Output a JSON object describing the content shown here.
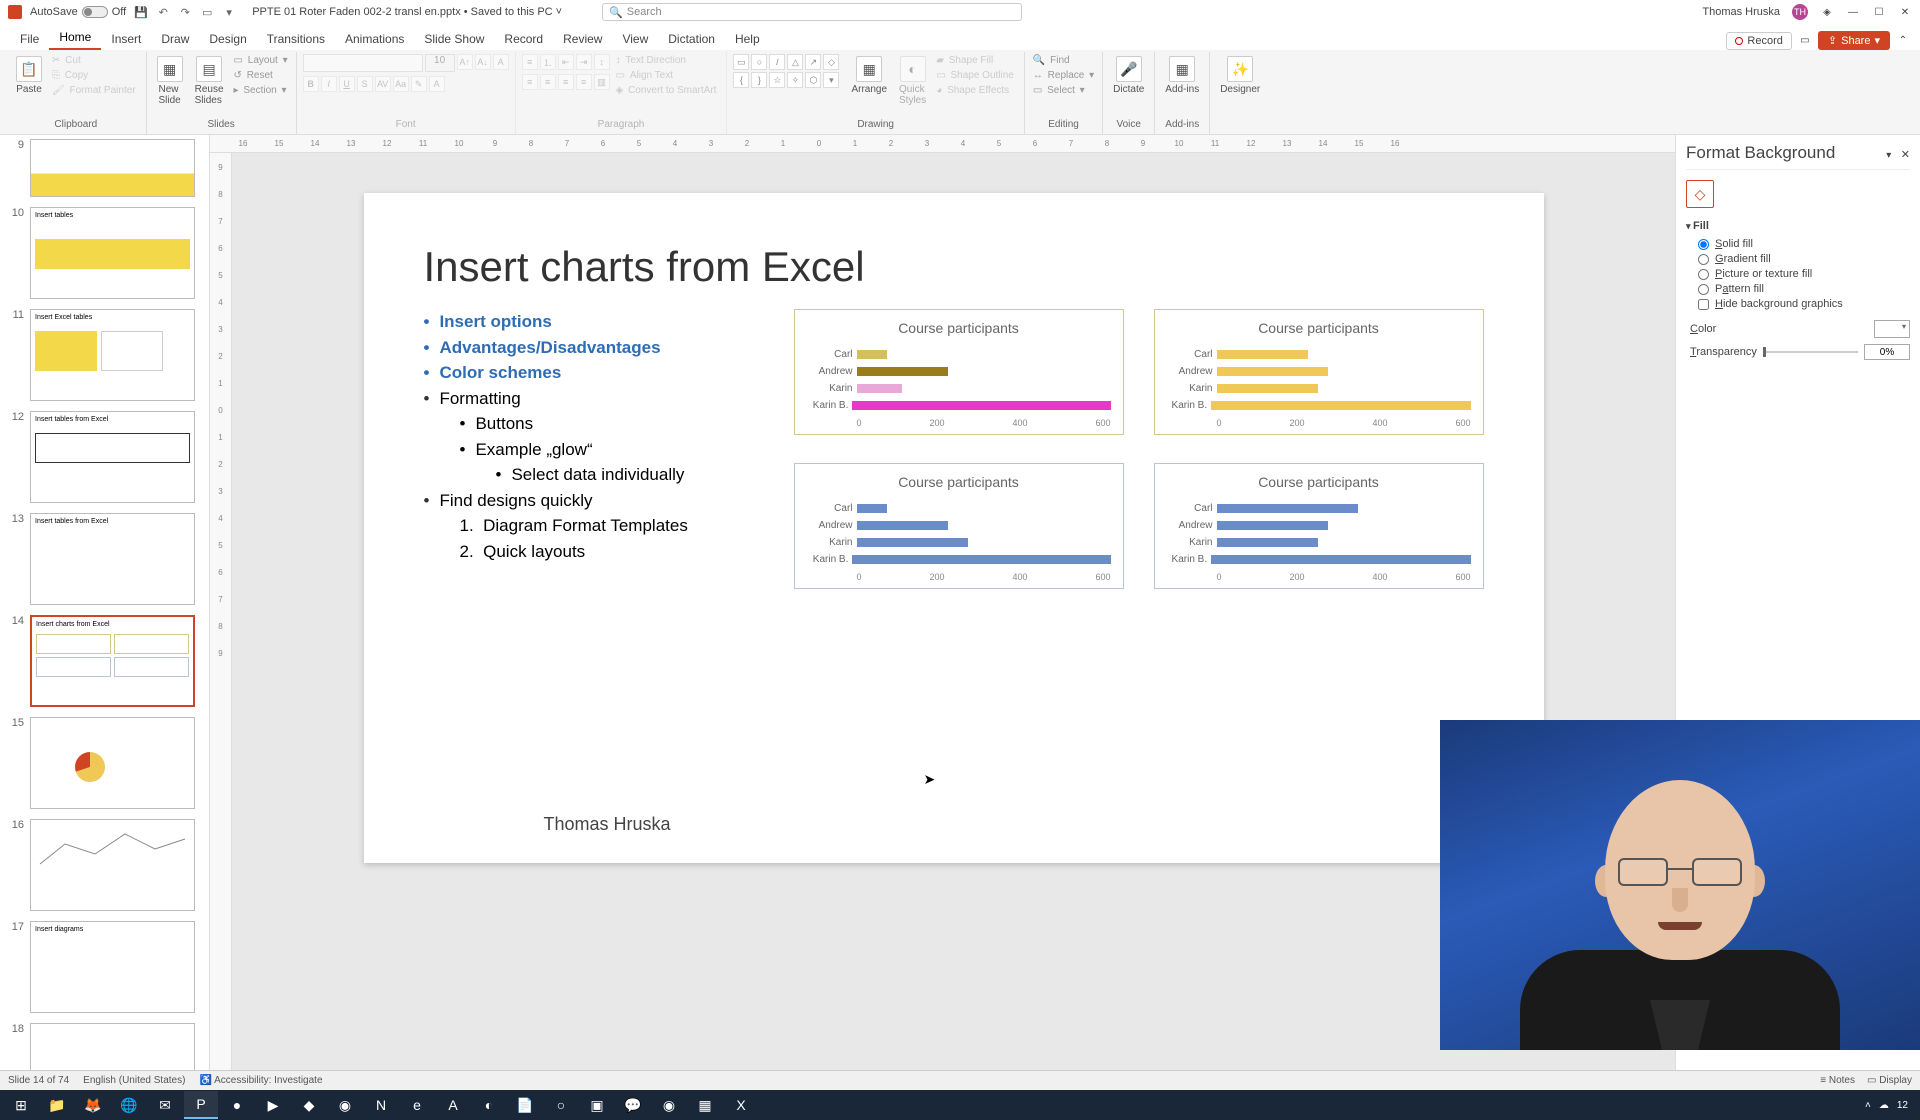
{
  "titlebar": {
    "autosave_label": "AutoSave",
    "autosave_state": "Off",
    "filename": "PPTE 01 Roter Faden 002-2 transl en.pptx",
    "saved_state": "Saved to this PC",
    "search_placeholder": "Search",
    "username": "Thomas Hruska",
    "avatar_initials": "TH"
  },
  "menu": {
    "tabs": [
      "File",
      "Home",
      "Insert",
      "Draw",
      "Design",
      "Transitions",
      "Animations",
      "Slide Show",
      "Record",
      "Review",
      "View",
      "Dictation",
      "Help"
    ],
    "active": "Home",
    "record_label": "Record",
    "share_label": "Share"
  },
  "ribbon": {
    "clipboard": {
      "paste": "Paste",
      "cut": "Cut",
      "copy": "Copy",
      "painter": "Format Painter",
      "label": "Clipboard"
    },
    "slides": {
      "new": "New\nSlide",
      "reuse": "Reuse\nSlides",
      "layout": "Layout",
      "reset": "Reset",
      "section": "Section",
      "label": "Slides"
    },
    "font": {
      "size": "10",
      "label": "Font"
    },
    "paragraph": {
      "textdir": "Text Direction",
      "align": "Align Text",
      "convert": "Convert to SmartArt",
      "label": "Paragraph"
    },
    "drawing": {
      "arrange": "Arrange",
      "quick": "Quick\nStyles",
      "fill": "Shape Fill",
      "outline": "Shape Outline",
      "effects": "Shape Effects",
      "label": "Drawing"
    },
    "editing": {
      "find": "Find",
      "replace": "Replace",
      "select": "Select",
      "label": "Editing"
    },
    "voice": {
      "dictate": "Dictate",
      "label": "Voice"
    },
    "addins": {
      "addins": "Add-ins",
      "label": "Add-ins"
    },
    "designer": {
      "designer": "Designer"
    }
  },
  "ruler_h": [
    "16",
    "15",
    "14",
    "13",
    "12",
    "11",
    "10",
    "9",
    "8",
    "7",
    "6",
    "5",
    "4",
    "3",
    "2",
    "1",
    "0",
    "1",
    "2",
    "3",
    "4",
    "5",
    "6",
    "7",
    "8",
    "9",
    "10",
    "11",
    "12",
    "13",
    "14",
    "15",
    "16"
  ],
  "ruler_v": [
    "9",
    "8",
    "7",
    "6",
    "5",
    "4",
    "3",
    "2",
    "1",
    "0",
    "1",
    "2",
    "3",
    "4",
    "5",
    "6",
    "7",
    "8",
    "9"
  ],
  "thumbs": [
    {
      "num": "9"
    },
    {
      "num": "10",
      "title": "Insert tables"
    },
    {
      "num": "11",
      "title": "Insert Excel tables"
    },
    {
      "num": "12",
      "title": "Insert tables from Excel"
    },
    {
      "num": "13",
      "title": "Insert tables from Excel"
    },
    {
      "num": "14",
      "title": "Insert charts from Excel",
      "selected": true
    },
    {
      "num": "15"
    },
    {
      "num": "16"
    },
    {
      "num": "17",
      "title": "Insert diagrams"
    },
    {
      "num": "18"
    }
  ],
  "slide": {
    "title": "Insert charts from Excel",
    "bullets": {
      "b1": "Insert options",
      "b2": "Advantages/Disadvantages",
      "b3": "Color schemes",
      "b4": "Formatting",
      "b4a": "Buttons",
      "b4b": "Example „glow“",
      "b4b1": "Select data individually",
      "b5": "Find designs quickly",
      "b5a": "Diagram Format Templates",
      "b5b": "Quick layouts"
    },
    "footer": "Thomas Hruska"
  },
  "chart_data": [
    {
      "type": "bar",
      "title": "Course participants",
      "categories": [
        "Carl",
        "Andrew",
        "Karin",
        "Karin B."
      ],
      "values": [
        60,
        180,
        90,
        560
      ],
      "colors": [
        "#d4c05a",
        "#9a7d1a",
        "#e8a8d8",
        "#e838c8"
      ],
      "xlim": [
        0,
        600
      ],
      "xticks": [
        0,
        200,
        400,
        600
      ]
    },
    {
      "type": "bar",
      "title": "Course participants",
      "categories": [
        "Carl",
        "Andrew",
        "Karin",
        "Karin B."
      ],
      "values": [
        180,
        220,
        200,
        580
      ],
      "colors": [
        "#f0c858",
        "#f0c858",
        "#f0c858",
        "#f0c858"
      ],
      "xlim": [
        0,
        600
      ],
      "xticks": [
        0,
        200,
        400,
        600
      ]
    },
    {
      "type": "bar",
      "title": "Course participants",
      "categories": [
        "Carl",
        "Andrew",
        "Karin",
        "Karin B."
      ],
      "values": [
        60,
        180,
        220,
        560
      ],
      "colors": [
        "#6a8cc8",
        "#6a8cc8",
        "#6a8cc8",
        "#6a8cc8"
      ],
      "xlim": [
        0,
        600
      ],
      "xticks": [
        0,
        200,
        400,
        600
      ]
    },
    {
      "type": "bar",
      "title": "Course participants",
      "categories": [
        "Carl",
        "Andrew",
        "Karin",
        "Karin B."
      ],
      "values": [
        280,
        220,
        200,
        580
      ],
      "colors": [
        "#6a8cc8",
        "#6a8cc8",
        "#6a8cc8",
        "#6a8cc8"
      ],
      "xlim": [
        0,
        600
      ],
      "xticks": [
        0,
        200,
        400,
        600
      ]
    }
  ],
  "format_panel": {
    "title": "Format Background",
    "fill_label": "Fill",
    "solid": "Solid fill",
    "gradient": "Gradient fill",
    "picture": "Picture or texture fill",
    "pattern": "Pattern fill",
    "hide": "Hide background graphics",
    "color_label": "Color",
    "transparency_label": "Transparency",
    "transparency_value": "0%"
  },
  "statusbar": {
    "slide": "Slide 14 of 74",
    "lang": "English (United States)",
    "access": "Accessibility: Investigate",
    "notes": "Notes",
    "display": "Display"
  },
  "taskbar": {
    "time": "12"
  }
}
